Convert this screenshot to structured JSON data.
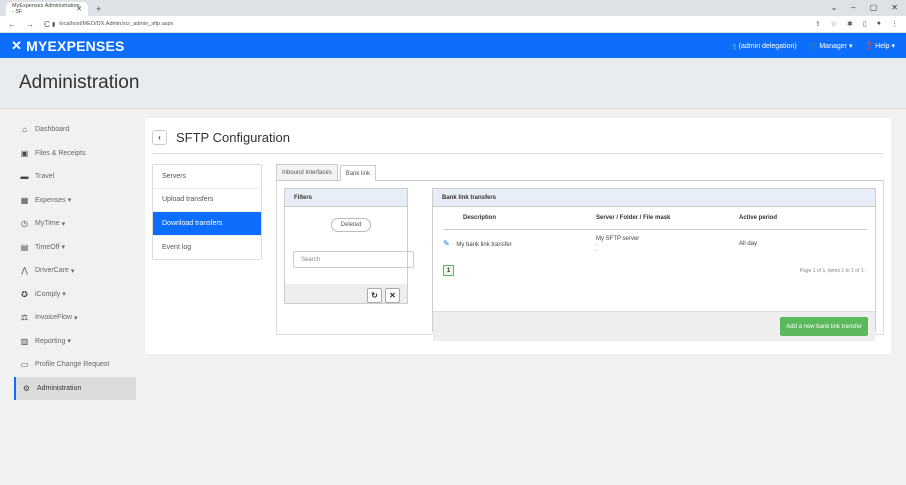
{
  "browser": {
    "tab_title": "MyExpenses Administration - SF",
    "url": "localhost/MEO/DX.Admin/scr_admin_sftp.aspx",
    "win_ctrls": [
      "⌄",
      "–",
      "▢",
      "✕"
    ]
  },
  "header": {
    "logo": "MYEXPENSES",
    "delegation": "(admin delegation)",
    "manager": "Manager",
    "help": "Help"
  },
  "page": {
    "title": "Administration"
  },
  "sidebar": {
    "items": [
      {
        "label": "Dashboard",
        "icon": "home-icon"
      },
      {
        "label": "Files & Receipts",
        "icon": "image-icon"
      },
      {
        "label": "Travel",
        "icon": "car-icon"
      },
      {
        "label": "Expenses",
        "icon": "calculator-icon",
        "caret": true
      },
      {
        "label": "MyTime",
        "icon": "clock-icon",
        "caret": true
      },
      {
        "label": "TimeOff",
        "icon": "calendar-icon",
        "caret": true
      },
      {
        "label": "DriverCare",
        "icon": "road-icon",
        "caret": true
      },
      {
        "label": "iComply",
        "icon": "badge-icon",
        "caret": true
      },
      {
        "label": "InvoiceFlow",
        "icon": "scale-icon",
        "caret": true
      },
      {
        "label": "Reporting",
        "icon": "chart-icon",
        "caret": true
      },
      {
        "label": "Profile Change Request",
        "icon": "profile-icon"
      },
      {
        "label": "Administration",
        "icon": "cogs-icon",
        "active": true
      }
    ]
  },
  "panel": {
    "back": "‹",
    "title": "SFTP Configuration"
  },
  "leftnav": [
    {
      "label": "Servers"
    },
    {
      "label": "Upload transfers"
    },
    {
      "label": "Download transfers",
      "active": true
    },
    {
      "label": "Event log"
    }
  ],
  "tabs": [
    {
      "label": "Inbound Interfaces"
    },
    {
      "label": "Bank link",
      "active": true
    }
  ],
  "filters": {
    "title": "Filters",
    "chip": "Deleted",
    "search_placeholder": "Search",
    "refresh_icon": "refresh-icon",
    "clear_icon": "clear-icon"
  },
  "transfers": {
    "title": "Bank link transfers",
    "columns": [
      "Description",
      "Server / Folder / File mask",
      "Active period"
    ],
    "rows": [
      {
        "description": "My bank link transfer",
        "server": "My SFTP server",
        "folder": "-",
        "mask": "-",
        "period": "All day"
      }
    ],
    "page": "1",
    "page_info": "Page 1 of 1, items 1 to 1 of 1.",
    "add_button": "Add a new bank link transfer"
  }
}
